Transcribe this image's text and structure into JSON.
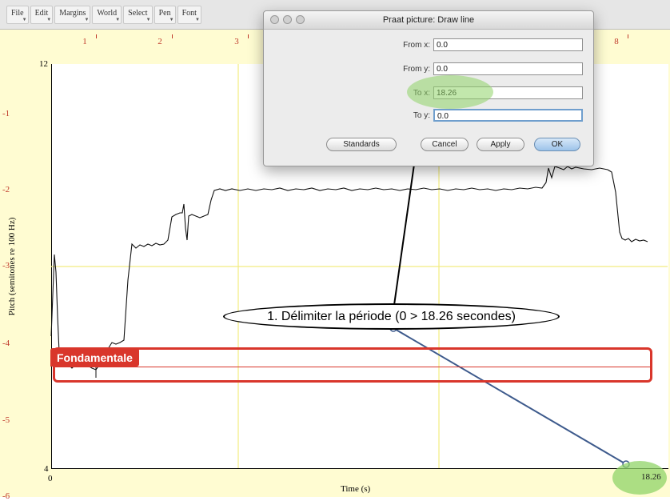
{
  "menubar": {
    "items": [
      {
        "label": "File"
      },
      {
        "label": "Edit"
      },
      {
        "label": "Margins"
      },
      {
        "label": "World"
      },
      {
        "label": "Select"
      },
      {
        "label": "Pen"
      },
      {
        "label": "Font"
      }
    ]
  },
  "rulers": {
    "top": [
      "1",
      "2",
      "3",
      "8"
    ],
    "left": [
      "-1",
      "-2",
      "-3",
      "-4",
      "-5",
      "-6"
    ]
  },
  "plot": {
    "y_top": "12",
    "y_bottom": "4",
    "x_left": "0",
    "x_right": "18.26",
    "xlabel": "Time (s)",
    "ylabel": "Pitch (semitones re 100 Hz)"
  },
  "dialog": {
    "title": "Praat picture: Draw line",
    "fields": [
      {
        "label": "From x:",
        "value": "0.0"
      },
      {
        "label": "From y:",
        "value": "0.0"
      },
      {
        "label": "To x:",
        "value": "18.26"
      },
      {
        "label": "To y:",
        "value": "0.0"
      }
    ],
    "buttons": {
      "standards": "Standards",
      "cancel": "Cancel",
      "apply": "Apply",
      "ok": "OK"
    }
  },
  "annotations": {
    "callout": "1. Délimiter la période (0 > 18.26 secondes)",
    "fond_label": "Fondamentale"
  },
  "colors": {
    "highlight": "#d9362b",
    "margin_bg": "#fffcd2",
    "grid": "#f2ec80",
    "marker_fill": "#90d468"
  }
}
